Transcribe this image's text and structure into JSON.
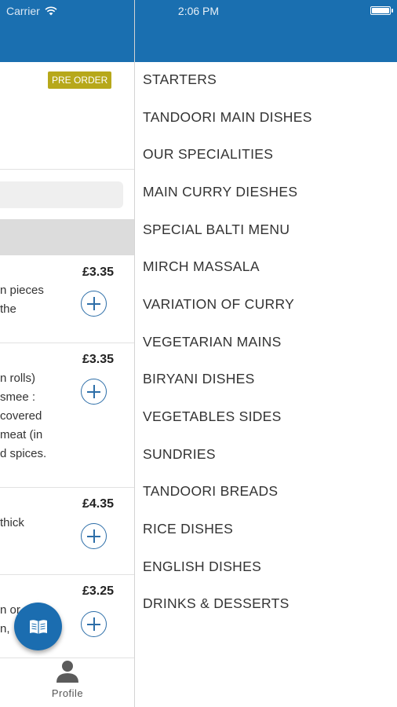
{
  "status_bar": {
    "carrier": "Carrier",
    "time": "2:06 PM"
  },
  "restaurant": {
    "badge": "PRE ORDER"
  },
  "items": [
    {
      "desc_lines": [
        "n pieces",
        "the"
      ],
      "price": "£3.35"
    },
    {
      "desc_lines": [
        "n rolls)",
        "smee :",
        "covered",
        "meat (in",
        "d spices."
      ],
      "price": "£3.35"
    },
    {
      "desc_lines": [
        "thick"
      ],
      "price": "£4.35"
    },
    {
      "desc_lines": [
        "n or",
        "n,"
      ],
      "price": "£3.25"
    }
  ],
  "bottom_nav": {
    "profile_label": "Profile"
  },
  "menu": {
    "categories": [
      "STARTERS",
      "TANDOORI MAIN DISHES",
      "OUR SPECIALITIES",
      "MAIN CURRY DIESHES",
      "SPECIAL BALTI MENU",
      "MIRCH MASSALA",
      "VARIATION OF CURRY",
      "VEGETARIAN MAINS",
      "BIRYANI DISHES",
      "VEGETABLES SIDES",
      "SUNDRIES",
      "TANDOORI BREADS",
      "RICE DISHES",
      "ENGLISH DISHES",
      "DRINKS & DESSERTS"
    ]
  },
  "colors": {
    "header": "#1a6fb0",
    "badge": "#b7a81a",
    "fab": "#1b6db0",
    "add_button": "#2d6ea8"
  }
}
